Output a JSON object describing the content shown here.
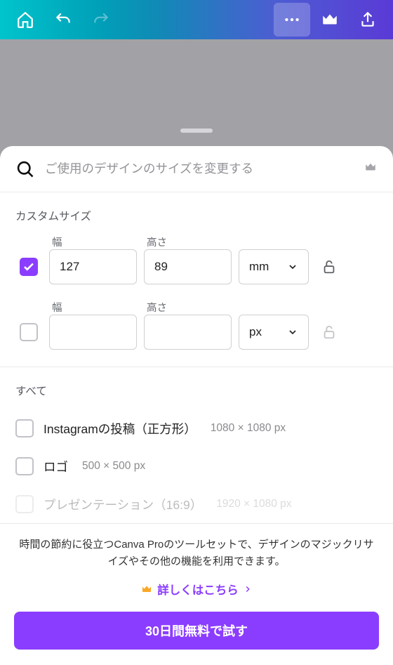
{
  "search": {
    "placeholder": "ご使用のデザインのサイズを変更する"
  },
  "customSize": {
    "section_label": "カスタムサイズ",
    "width_label": "幅",
    "height_label": "高さ",
    "rows": [
      {
        "checked": true,
        "width": "127",
        "height": "89",
        "unit": "mm",
        "lock_disabled": false
      },
      {
        "checked": false,
        "width": "",
        "height": "",
        "unit": "px",
        "lock_disabled": true
      }
    ]
  },
  "all": {
    "section_label": "すべて",
    "items": [
      {
        "title": "Instagramの投稿（正方形）",
        "dims": "1080 × 1080 px"
      },
      {
        "title": "ロゴ",
        "dims": "500 × 500 px"
      },
      {
        "title": "プレゼンテーション（16:9）",
        "dims": "1920 × 1080 px"
      }
    ]
  },
  "footer": {
    "promo": "時間の節約に役立つCanva Proのツールセットで、デザインのマジックリサイズやその他の機能を利用できます。",
    "learn_more": "詳しくはこちら",
    "cta": "30日間無料で試す"
  }
}
